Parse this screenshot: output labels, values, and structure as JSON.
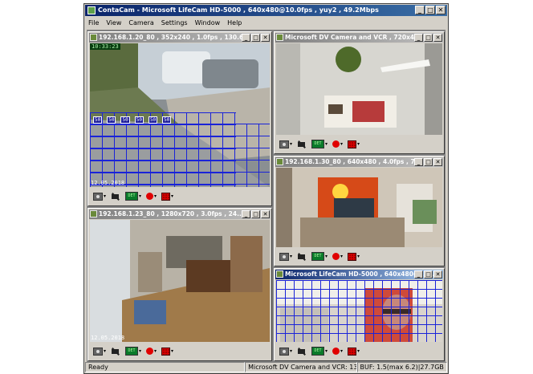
{
  "app": {
    "title": "ContaCam - Microsoft LifeCam HD-5000 , 640x480@10.0fps , yuy2 , 49.2Mbps",
    "window_buttons": [
      "_",
      "□",
      "✕"
    ]
  },
  "menu": [
    "File",
    "View",
    "Camera",
    "Settings",
    "Window",
    "Help"
  ],
  "cameras": [
    {
      "title": "192.168.1.20_80 , 352x240 , 1.0fps , 130.6...",
      "osd_time": "10:33:23",
      "osd_date": "12.05.2018",
      "detection_values": [
        "50",
        "50",
        "50",
        "50",
        "50",
        "50"
      ]
    },
    {
      "title": "Microsoft DV Camera and VCR , 720x480 ..."
    },
    {
      "title": "192.168.1.30_80 , 640x480 , 4.0fps , 73..."
    },
    {
      "title": "192.168.1.23_80 , 1280x720 , 3.0fps , 24...",
      "osd_date": "12.05.2018"
    },
    {
      "title": "Microsoft LifeCam HD-5000 , 640x480@10..."
    }
  ],
  "toolbar": {
    "det_label": "DET",
    "dropdown": "▾"
  },
  "status": {
    "left": "Ready",
    "middle": "Microsoft DV Camera and VCR: 13.04x",
    "right": "BUF: 1.5(max 6.2)|27.7GB"
  },
  "colors": {
    "active_title": "#0a246a",
    "inactive_title": "#808080",
    "motion_grid": "#1a23d8",
    "record": "#e00000"
  }
}
